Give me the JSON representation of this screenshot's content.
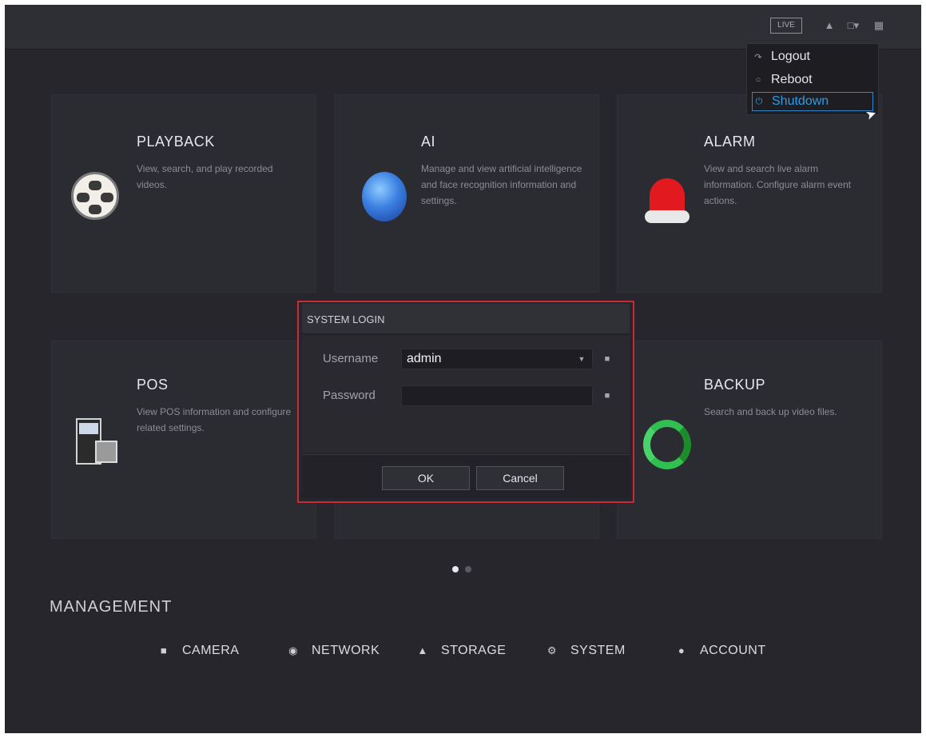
{
  "topbar": {
    "live_label": "LIVE",
    "icons": [
      "user-icon",
      "power-menu-icon",
      "grid-icon"
    ]
  },
  "power_menu": {
    "items": [
      {
        "label": "Logout",
        "icon": "logout-icon"
      },
      {
        "label": "Reboot",
        "icon": "reboot-icon"
      },
      {
        "label": "Shutdown",
        "icon": "shutdown-icon",
        "selected": true
      }
    ]
  },
  "cards": {
    "playback": {
      "title": "PLAYBACK",
      "desc": "View, search, and play recorded videos."
    },
    "ai": {
      "title": "AI",
      "desc": "Manage and view artificial intelligence and face recognition information and settings."
    },
    "alarm": {
      "title": "ALARM",
      "desc": "View and search live alarm information. Configure alarm event actions."
    },
    "pos": {
      "title": "POS",
      "desc": "View POS information and configure related settings."
    },
    "backup": {
      "title": "BACKUP",
      "desc": "Search and back up video files."
    }
  },
  "login_dialog": {
    "title": "SYSTEM LOGIN",
    "username_label": "Username",
    "username_value": "admin",
    "password_label": "Password",
    "password_value": "",
    "ok_label": "OK",
    "cancel_label": "Cancel",
    "highlight_color": "#c82a37"
  },
  "pagination": {
    "pages": 2,
    "current": 1
  },
  "management": {
    "title": "MANAGEMENT",
    "items": [
      {
        "label": "CAMERA",
        "icon": "camera-icon"
      },
      {
        "label": "NETWORK",
        "icon": "network-icon"
      },
      {
        "label": "STORAGE",
        "icon": "storage-icon"
      },
      {
        "label": "SYSTEM",
        "icon": "system-gear-icon"
      },
      {
        "label": "ACCOUNT",
        "icon": "account-icon"
      }
    ]
  },
  "colors": {
    "background": "#26262c",
    "accent_blue": "#2f9be6",
    "alarm_red": "#e2191f",
    "backup_green": "#30c050"
  }
}
